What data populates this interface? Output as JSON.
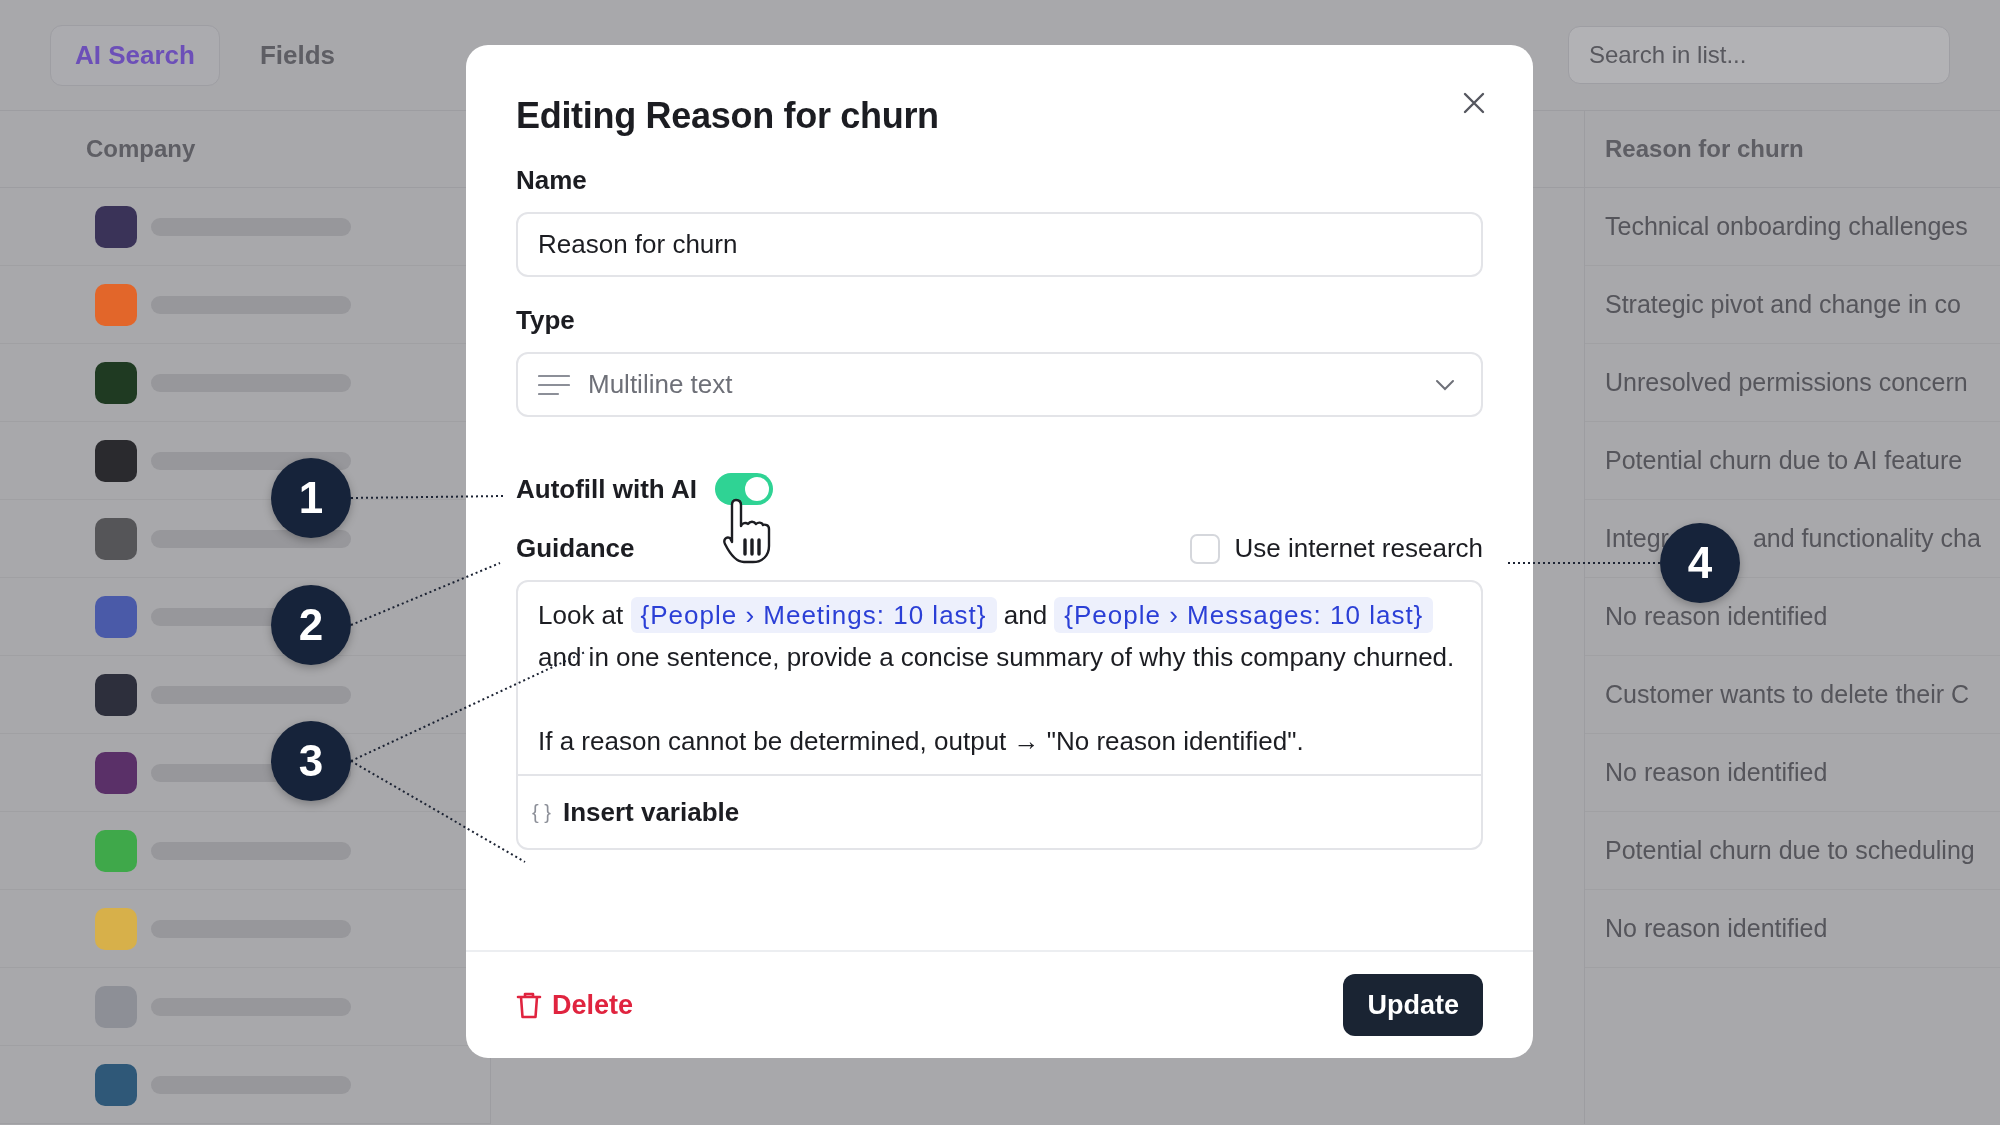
{
  "background": {
    "toolbar": {
      "ai_search": "AI Search",
      "fields": "Fields",
      "search_placeholder": "Search in list..."
    },
    "columns": [
      "Company",
      "Reason for churn"
    ],
    "companies": [
      {
        "color": "#3a3358"
      },
      {
        "color": "#e2662a"
      },
      {
        "color": "#1f3a22"
      },
      {
        "color": "#2a2a2e"
      },
      {
        "color": "#555558"
      },
      {
        "color": "#4a5aa8"
      },
      {
        "color": "#2d2f3c"
      },
      {
        "color": "#5a3068"
      },
      {
        "color": "#3fa84a"
      },
      {
        "color": "#d7b04a"
      },
      {
        "color": "#8d8f96"
      },
      {
        "color": "#2f5878"
      }
    ],
    "reasons": [
      [
        "Technical onboarding challenges"
      ],
      [
        "Strategic pivot and change in co"
      ],
      [
        "Unresolved permissions concern"
      ],
      [
        "Potential churn due to AI feature"
      ],
      [
        "Integr",
        "and functionality cha"
      ],
      [
        "No reason identified"
      ],
      [
        "Customer wants to delete their C"
      ],
      [
        "No reason identified"
      ],
      [
        "Potential churn due to scheduling"
      ],
      [
        "No reason identified"
      ]
    ]
  },
  "dialog": {
    "title": "Editing Reason for churn",
    "name_label": "Name",
    "name_value": "Reason for churn",
    "type_label": "Type",
    "type_value": "Multiline text",
    "autofill": {
      "label": "Autofill with AI",
      "on": true
    },
    "guidance_label": "Guidance",
    "internet_research": {
      "label": "Use internet research",
      "checked": false
    },
    "guidance": [
      [
        {
          "kind": "text",
          "text": "Look at "
        },
        {
          "kind": "variable",
          "text": "{People › Meetings: 10 last}"
        },
        {
          "kind": "text",
          "text": " and "
        },
        {
          "kind": "variable",
          "text": "{People › Messages: 10 last}"
        },
        {
          "kind": "text",
          "text": " and in one sentence, provide a concise summary of why this company churned."
        }
      ],
      [
        {
          "kind": "text",
          "text": "If a reason cannot be determined, output → \"No reason identified\"."
        }
      ]
    ],
    "insert_variable": {
      "icon": "{ }",
      "label": "Insert variable"
    },
    "delete": "Delete",
    "update": "Update"
  },
  "callouts": [
    "1",
    "2",
    "3",
    "4"
  ]
}
